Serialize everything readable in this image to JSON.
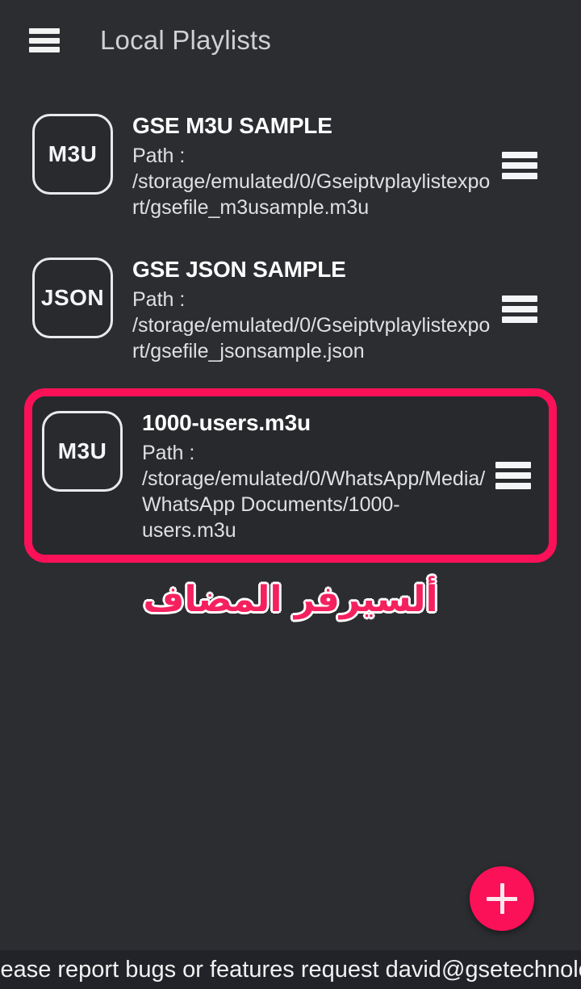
{
  "appbar": {
    "menu_icon": "hamburger-menu-icon",
    "title": "Local Playlists"
  },
  "playlists": [
    {
      "badge": "M3U",
      "title": "GSE M3U SAMPLE",
      "path": "Path : /storage/emulated/0/Gseiptvplaylistexport/gsefile_m3usample.m3u",
      "handle_icon": "drag-handle-icon",
      "highlighted": false
    },
    {
      "badge": "JSON",
      "title": "GSE JSON SAMPLE",
      "path": "Path : /storage/emulated/0/Gseiptvplaylistexport/gsefile_jsonsample.json",
      "handle_icon": "drag-handle-icon",
      "highlighted": false
    },
    {
      "badge": "M3U",
      "title": "1000-users.m3u",
      "path": "Path : /storage/emulated/0/WhatsApp/Media/WhatsApp Documents/1000-users.m3u",
      "handle_icon": "drag-handle-icon",
      "highlighted": true
    }
  ],
  "annotation": {
    "text": "ألسيرفر المضاف"
  },
  "fab": {
    "icon": "plus-icon",
    "label": "+"
  },
  "ticker": {
    "text": "lease report bugs or features request david@gsetechnology.co.uk o"
  },
  "colors": {
    "background": "#2b2d31",
    "card": "#28292d",
    "accent": "#fa1158",
    "title_text": "#ffffff",
    "path_text": "#dfe0e2",
    "appbar_title": "#cfd0d2",
    "ticker_background": "#212328"
  }
}
